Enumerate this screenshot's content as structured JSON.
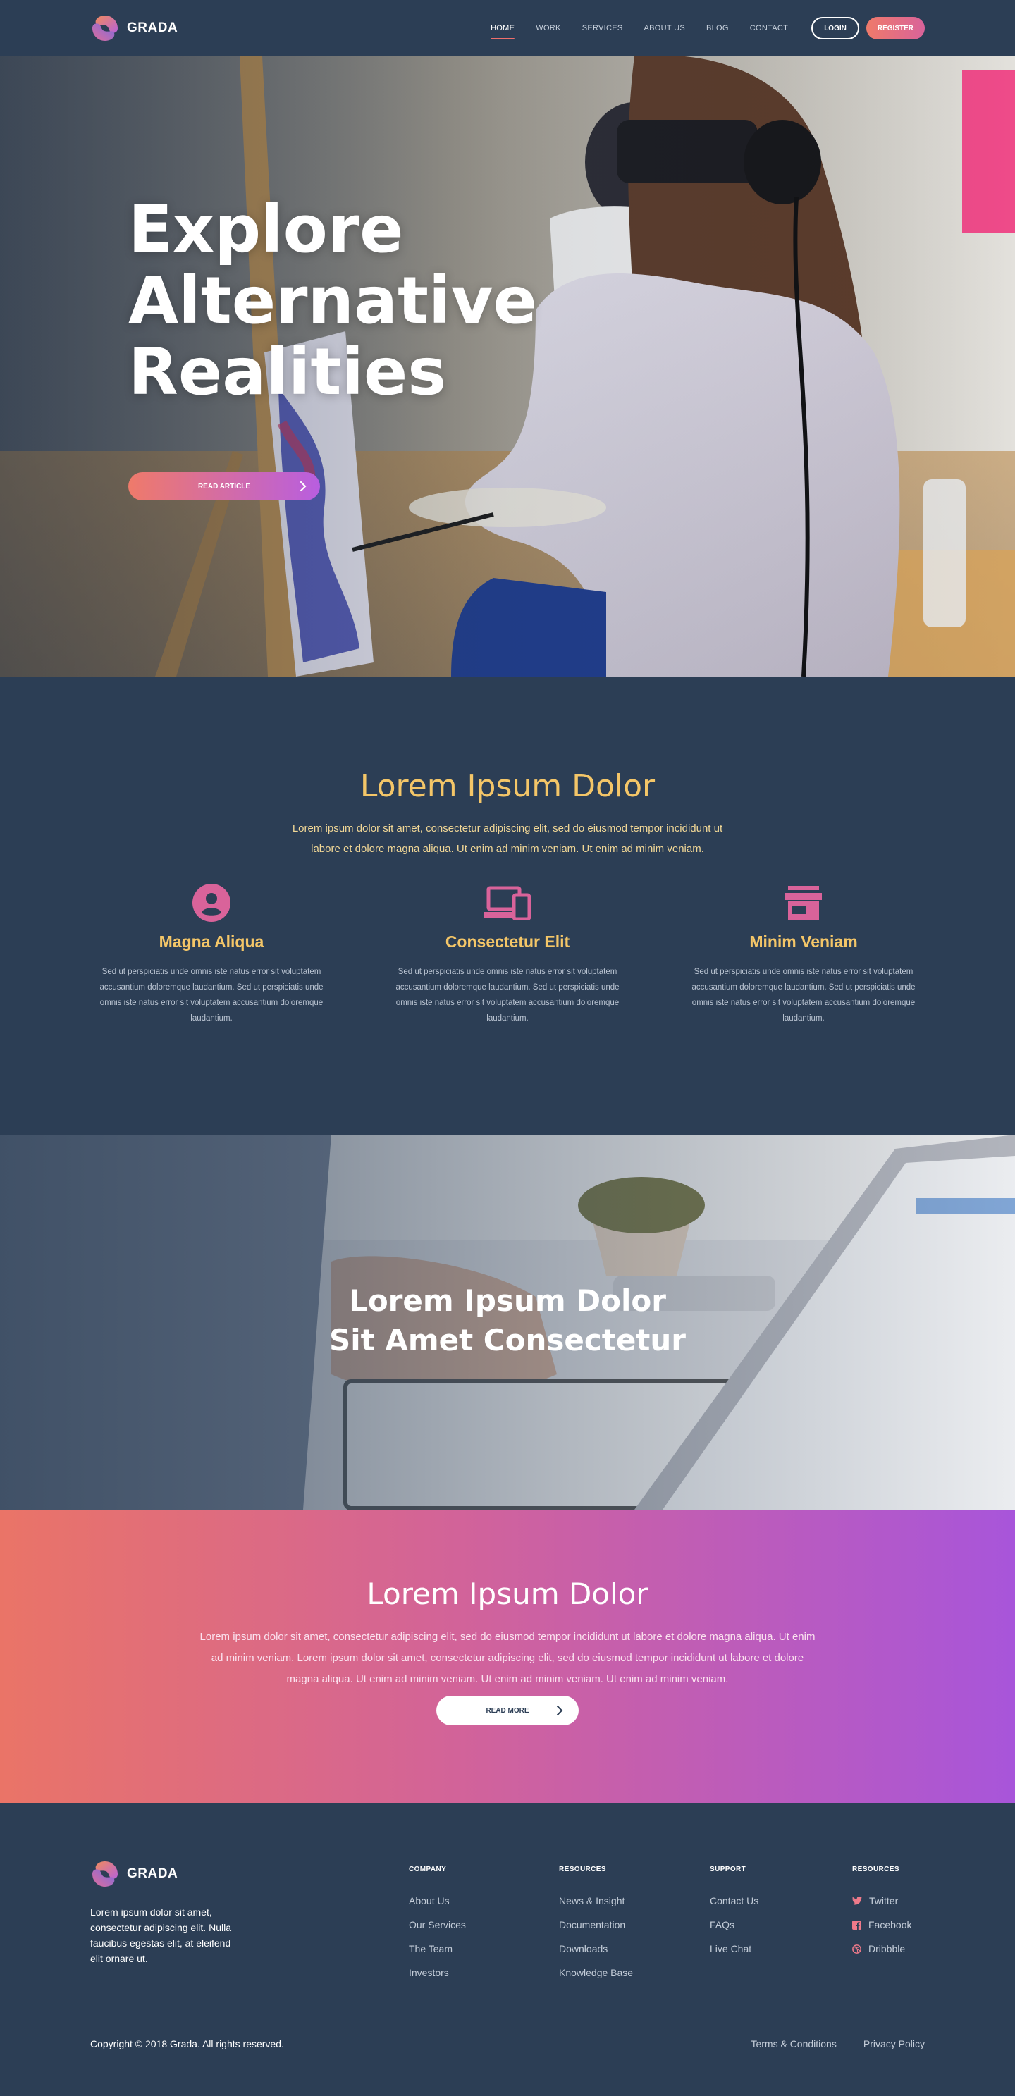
{
  "brand": {
    "name": "GRADA"
  },
  "nav": {
    "links": [
      "HOME",
      "WORK",
      "SERVICES",
      "ABOUT US",
      "BLOG",
      "CONTACT"
    ],
    "login": "LOGIN",
    "register": "REGISTER"
  },
  "hero": {
    "title_lines": [
      "Explore",
      "Alternative",
      "Realities"
    ],
    "button": "READ ARTICLE"
  },
  "features": {
    "title": "Lorem Ipsum Dolor",
    "lead": "Lorem ipsum dolor sit amet, consectetur adipiscing elit, sed do eiusmod tempor incididunt ut labore et dolore magna aliqua. Ut enim ad minim veniam. Ut enim ad minim veniam.",
    "items": [
      {
        "icon": "account-circle-icon",
        "title": "Magna Aliqua",
        "text": "Sed ut perspiciatis unde omnis iste natus error sit voluptatem accusantium doloremque laudantium. Sed ut perspiciatis unde omnis iste natus error sit voluptatem accusantium doloremque laudantium."
      },
      {
        "icon": "devices-icon",
        "title": "Consectetur Elit",
        "text": "Sed ut perspiciatis unde omnis iste natus error sit voluptatem accusantium doloremque laudantium. Sed ut perspiciatis unde omnis iste natus error sit voluptatem accusantium doloremque laudantium."
      },
      {
        "icon": "store-icon",
        "title": "Minim Veniam",
        "text": "Sed ut perspiciatis unde omnis iste natus error sit voluptatem accusantium doloremque laudantium. Sed ut perspiciatis unde omnis iste natus error sit voluptatem accusantium doloremque laudantium."
      }
    ]
  },
  "banner": {
    "title_lines": [
      "Lorem Ipsum Dolor",
      "Sit Amet Consectetur"
    ]
  },
  "cta": {
    "title": "Lorem Ipsum Dolor",
    "text": "Lorem ipsum dolor sit amet, consectetur adipiscing elit, sed do eiusmod tempor incididunt ut labore et dolore magna aliqua. Ut enim ad minim veniam. Lorem ipsum dolor sit amet, consectetur adipiscing elit, sed do eiusmod tempor incididunt ut labore et dolore magna aliqua. Ut enim ad minim veniam. Ut enim ad minim veniam. Ut enim ad minim veniam.",
    "button": "READ MORE"
  },
  "footer": {
    "about": "Lorem ipsum dolor sit amet, consectetur adipiscing elit. Nulla faucibus egestas elit, at eleifend elit ornare ut.",
    "columns": [
      {
        "heading": "COMPANY",
        "links": [
          "About Us",
          "Our Services",
          "The Team",
          "Investors"
        ]
      },
      {
        "heading": "RESOURCES",
        "links": [
          "News & Insight",
          "Documentation",
          "Downloads",
          "Knowledge Base"
        ]
      },
      {
        "heading": "SUPPORT",
        "links": [
          "Contact Us",
          "FAQs",
          "Live Chat"
        ]
      },
      {
        "heading": "RESOURCES",
        "links": [
          "Twitter",
          "Facebook",
          "Dribbble"
        ],
        "icons": [
          "twitter-icon",
          "facebook-icon",
          "dribbble-icon"
        ]
      }
    ],
    "copyright": "Copyright © 2018 Grada. All rights reserved.",
    "legal": [
      "Terms & Conditions",
      "Privacy Policy"
    ]
  },
  "colors": {
    "navy": "#2c3e55",
    "gold": "#f4c668",
    "coral": "#ef7a6a",
    "pink": "#d9639a",
    "purple": "#a855da"
  }
}
